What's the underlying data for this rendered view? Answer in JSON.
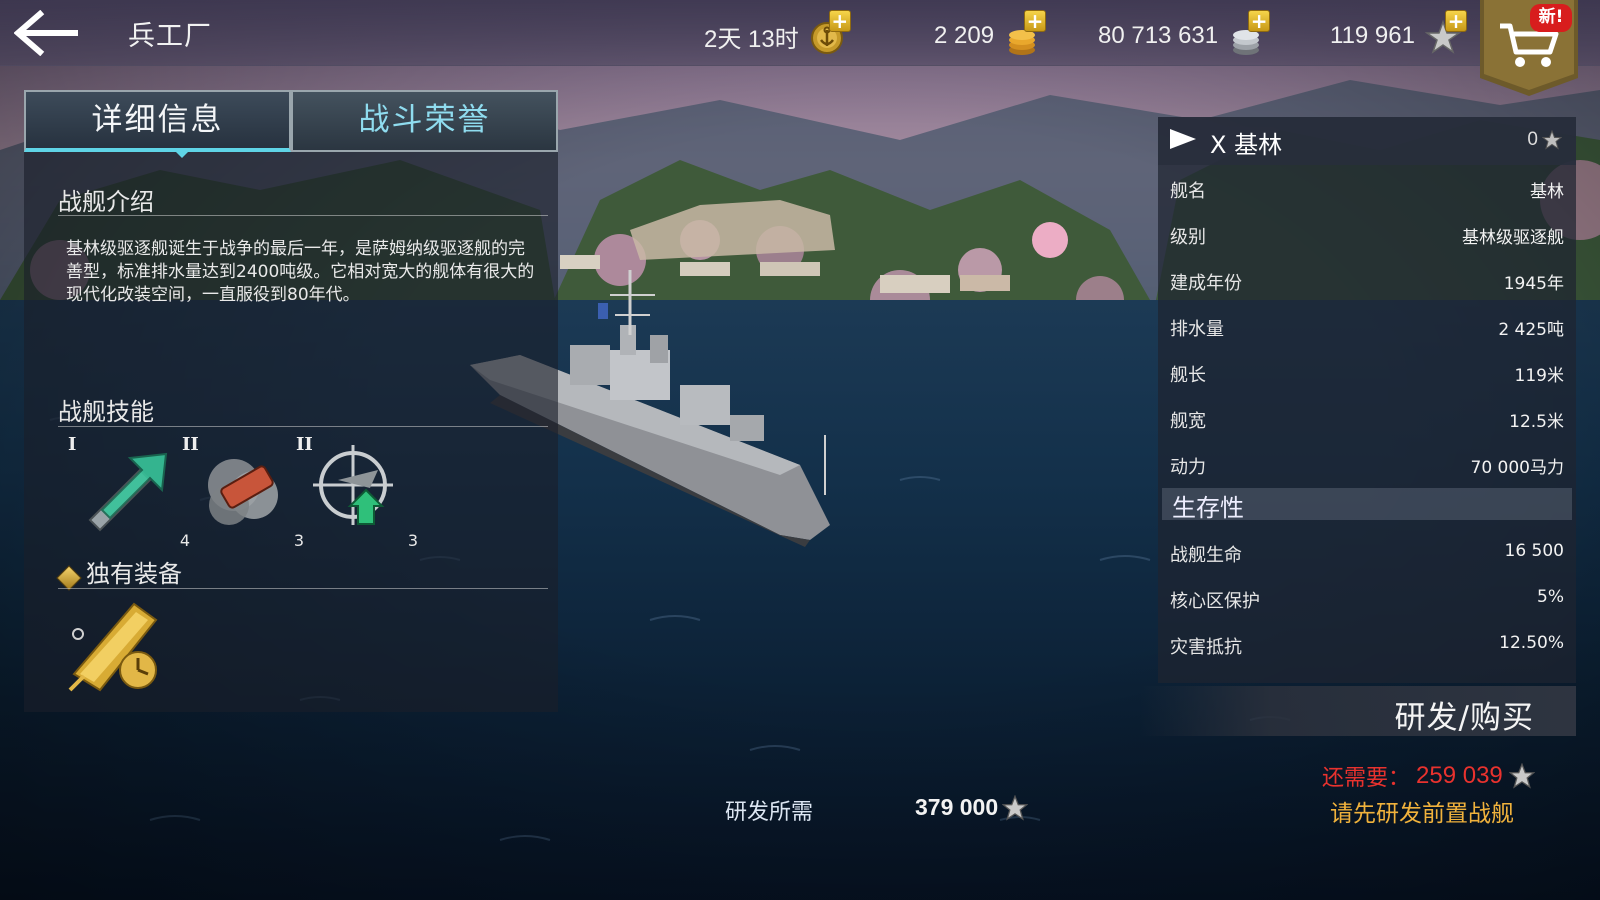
{
  "header": {
    "title": "兵工厂",
    "resources": [
      {
        "icon": "anchor-medal-icon",
        "value": "2天 13时"
      },
      {
        "icon": "gold-coins-icon",
        "value": "2 209"
      },
      {
        "icon": "silver-coins-icon",
        "value": "80 713 631"
      },
      {
        "icon": "star-icon",
        "value": "119 961"
      }
    ],
    "shop_badge": "新!"
  },
  "tabs": [
    {
      "label": "详细信息",
      "active": true
    },
    {
      "label": "战斗荣誉",
      "active": false
    }
  ],
  "intro": {
    "title": "战舰介绍",
    "text": "基林级驱逐舰诞生于战争的最后一年，是萨姆纳级驱逐舰的完善型，标准排水量达到2400吨级。它相对宽大的舰体有很大的现代化改装空间，一直服役到80年代。"
  },
  "skills": {
    "title": "战舰技能",
    "items": [
      {
        "tier": "I",
        "level": "4",
        "icon": "ship-speed-boost-icon"
      },
      {
        "tier": "II",
        "level": "3",
        "icon": "smoke-canister-icon"
      },
      {
        "tier": "II",
        "level": "3",
        "icon": "anti-air-target-boost-icon"
      }
    ]
  },
  "equipment": {
    "title": "独有装备",
    "icon": "golden-torpedo-reload-icon"
  },
  "ship_panel": {
    "tier": "X",
    "name": "基林",
    "stars": "0",
    "stats": [
      {
        "label": "舰名",
        "value": "基林"
      },
      {
        "label": "级别",
        "value": "基林级驱逐舰"
      },
      {
        "label": "建成年份",
        "value": "1945年"
      },
      {
        "label": "排水量",
        "value": "2 425吨"
      },
      {
        "label": "舰长",
        "value": "119米"
      },
      {
        "label": "舰宽",
        "value": "12.5米"
      },
      {
        "label": "动力",
        "value": "70 000马力"
      }
    ],
    "survival_title": "生存性",
    "survival": [
      {
        "label": "战舰生命",
        "value": "16 500"
      },
      {
        "label": "核心区保护",
        "value": "5%"
      },
      {
        "label": "灾害抵抗",
        "value": "12.50%"
      }
    ]
  },
  "actions": {
    "buy_label": "研发/购买",
    "need_label": "还需要：",
    "need_value": "259 039",
    "prereq_text": "请先研发前置战舰"
  },
  "research": {
    "cost_label": "研发所需",
    "cost_value": "379 000"
  }
}
